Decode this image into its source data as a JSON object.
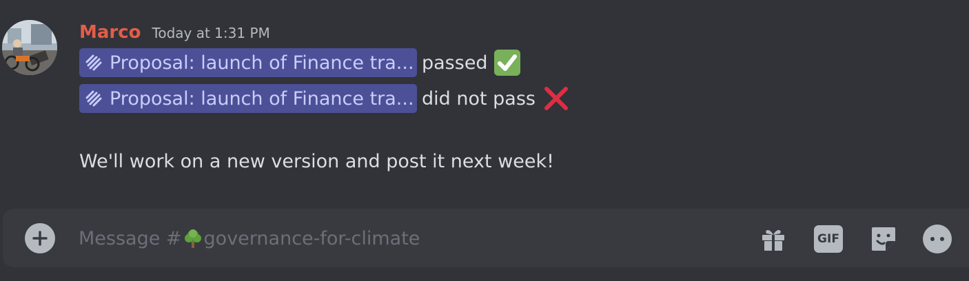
{
  "message": {
    "author": "Marco",
    "timestamp": "Today at 1:31 PM",
    "lines": [
      {
        "mention": "Proposal: launch of Finance tra...",
        "mention_icon": "proposal-stripes-icon",
        "text": "passed",
        "emoji": "white-check-mark-icon"
      },
      {
        "mention": "Proposal: launch of Finance tra...",
        "mention_icon": "proposal-stripes-icon",
        "text": "did not pass",
        "emoji": "red-cross-mark-icon"
      }
    ],
    "body": "We'll work on a new version and post it next week!"
  },
  "composer": {
    "placeholder_prefix": "Message #",
    "channel_emoji": "tree-icon",
    "channel_name": "governance-for-climate",
    "gif_label": "GIF",
    "buttons": [
      "add-attachment-icon",
      "gift-icon",
      "gif-icon",
      "sticker-icon",
      "emoji-icon"
    ]
  },
  "colors": {
    "background": "#313338",
    "composer": "#383a40",
    "username": "#e45c4a",
    "mention_bg": "#4c5096",
    "mention_text": "#c9cdfb"
  }
}
